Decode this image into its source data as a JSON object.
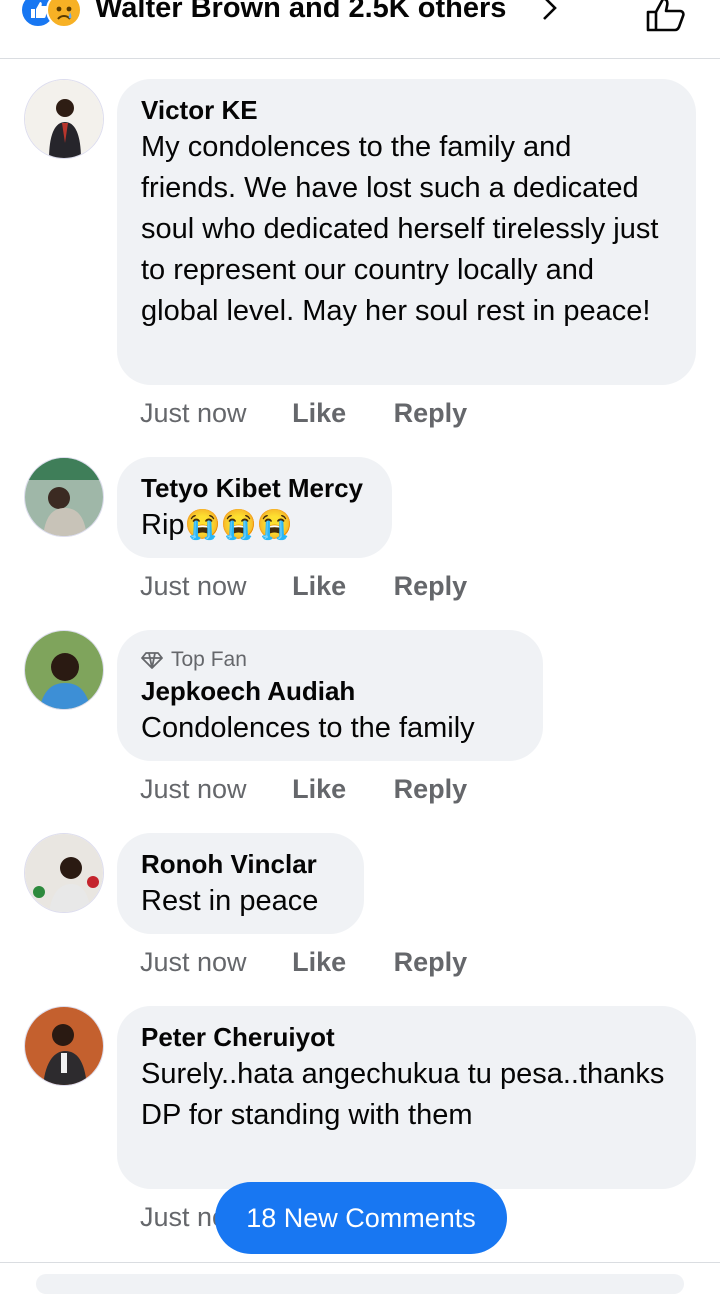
{
  "header": {
    "reactions_text": "Walter Brown and 2.5K others",
    "like_color": "#1877f2",
    "sad_color": "#f7b125"
  },
  "comments": [
    {
      "author": "Victor KE",
      "text": "My condolences to the family and friends. We have lost such a dedicated soul who dedicated herself tirelessly just to represent our country locally and global level. May her soul rest in peace!",
      "time": "Just now",
      "like": "Like",
      "reply": "Reply"
    },
    {
      "author": "Tetyo Kibet Mercy",
      "text": "Rip😭😭😭",
      "time": "Just now",
      "like": "Like",
      "reply": "Reply"
    },
    {
      "badge": "Top Fan",
      "author": "Jepkoech Audiah",
      "text": "Condolences to the family",
      "time": "Just now",
      "like": "Like",
      "reply": "Reply"
    },
    {
      "author": "Ronoh Vinclar",
      "text": "Rest in peace",
      "time": "Just now",
      "like": "Like",
      "reply": "Reply"
    },
    {
      "author": "Peter Cheruiyot",
      "text": "Surely..hata angechukua tu pesa..thanks DP for standing with them",
      "time": "Just now"
    }
  ],
  "new_comments_label": "18 New Comments",
  "accent_color": "#1877f2"
}
